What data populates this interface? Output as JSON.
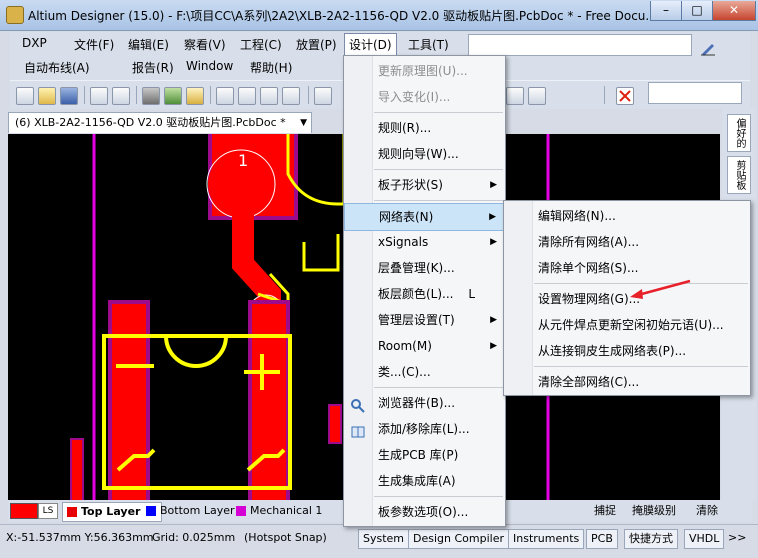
{
  "window": {
    "title": "Altium Designer (15.0) - F:\\项目CC\\A系列\\2A2\\XLB-2A2-1156-QD V2.0 驱动板贴片图.PcbDoc * - Free Docu...",
    "minimize": "–",
    "maximize": "□",
    "close": "✕"
  },
  "menubar": {
    "row1": [
      "DXP",
      "文件(F)",
      "编辑(E)",
      "察看(V)",
      "工程(C)",
      "放置(P)",
      "设计(D)",
      "工具(T)"
    ],
    "row2": [
      "自动布线(A)",
      "报告(R)",
      "Window",
      "帮助(H)"
    ]
  },
  "document_tab": {
    "label": "(6) XLB-2A2-1156-QD V2.0 驱动板贴片图.PcbDoc *"
  },
  "right_panel": {
    "tabs": [
      "偏好的",
      "剪贴板"
    ]
  },
  "design_menu": {
    "items": [
      {
        "label": "更新原理图(U)...",
        "disabled": true
      },
      {
        "label": "导入变化(I)...",
        "disabled": true
      },
      {
        "label": "规则(R)..."
      },
      {
        "label": "规则向导(W)..."
      },
      {
        "label": "板子形状(S)",
        "submenu": true
      },
      {
        "label": "网络表(N)",
        "submenu": true,
        "highlighted": true
      },
      {
        "label": "xSignals",
        "submenu": true
      },
      {
        "label": "层叠管理(K)..."
      },
      {
        "label": "板层颜色(L)...",
        "shortcut": "L"
      },
      {
        "label": "管理层设置(T)",
        "submenu": true
      },
      {
        "label": "Room(M)",
        "submenu": true
      },
      {
        "label": "类...(C)..."
      },
      {
        "label": "浏览器件(B)..."
      },
      {
        "label": "添加/移除库(L)..."
      },
      {
        "label": "生成PCB 库(P)"
      },
      {
        "label": "生成集成库(A)"
      },
      {
        "label": "板参数选项(O)..."
      }
    ]
  },
  "netlist_submenu": {
    "items": [
      {
        "label": "编辑网络(N)..."
      },
      {
        "label": "清除所有网络(A)..."
      },
      {
        "label": "清除单个网络(S)..."
      },
      {
        "label": "设置物理网络(G)..."
      },
      {
        "label": "从元件焊点更新空闲初始元语(U)..."
      },
      {
        "label": "从连接铜皮生成网络表(P)..."
      },
      {
        "label": "清除全部网络(C)..."
      }
    ]
  },
  "layers": {
    "ls": "LS",
    "tabs": [
      {
        "label": "Top Layer",
        "color": "#e60000"
      },
      {
        "label": "Bottom Layer",
        "color": "#0000ff"
      },
      {
        "label": "Mechanical 1",
        "color": "#d400d4"
      }
    ],
    "right_labels": [
      "捕捉",
      "掩膜级别",
      "清除"
    ]
  },
  "status": {
    "coords": "X:-51.537mm Y:56.363mm",
    "grid": "Grid: 0.025mm",
    "snap": "(Hotspot Snap)",
    "buttons": [
      "System",
      "Design Compiler",
      "Instruments",
      "PCB",
      "快捷方式",
      "VHDL"
    ],
    "more": ">>"
  },
  "pcb": {
    "pad_label": "1",
    "colors": {
      "copper": "#ff0000",
      "silkscreen": "#ffff00",
      "mechanical": "#e600e6",
      "board": "#000000",
      "solder_mask": "#9e0a8c"
    }
  },
  "colors": {
    "menu_highlight": "#cce4f7",
    "annotation_arrow": "#e8202a"
  }
}
